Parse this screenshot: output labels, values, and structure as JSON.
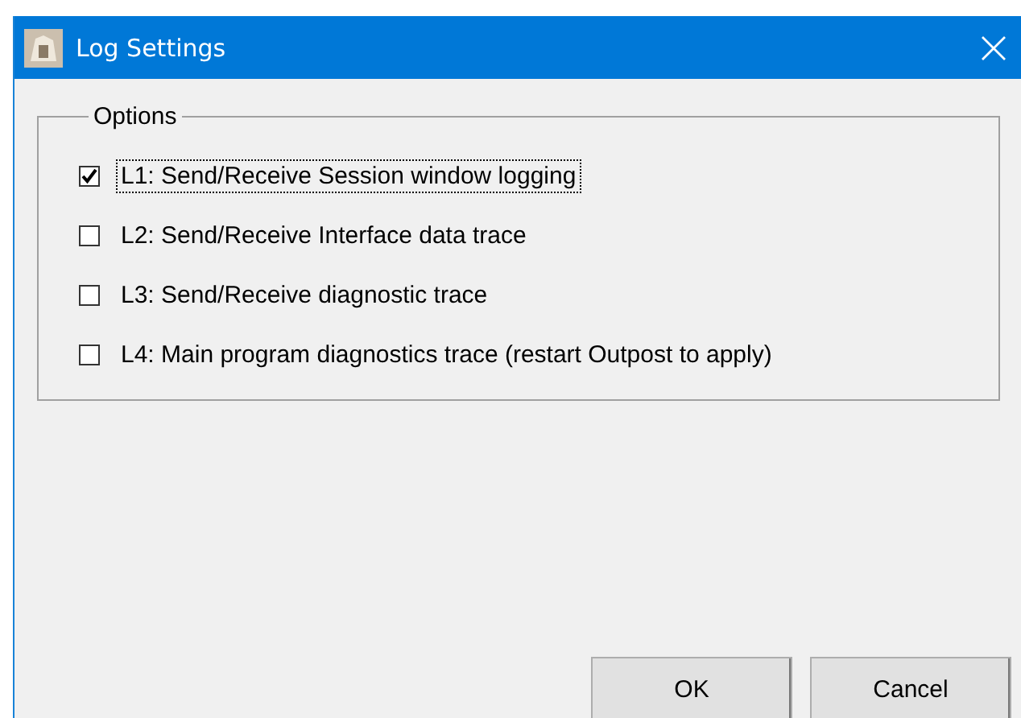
{
  "window": {
    "title": "Log Settings"
  },
  "options": {
    "title": "Options",
    "items": [
      {
        "label": "L1: Send/Receive Session window logging",
        "checked": true,
        "focused": true
      },
      {
        "label": "L2: Send/Receive Interface data trace",
        "checked": false,
        "focused": false
      },
      {
        "label": "L3: Send/Receive diagnostic trace",
        "checked": false,
        "focused": false
      },
      {
        "label": "L4: Main program diagnostics trace (restart Outpost to apply)",
        "checked": false,
        "focused": false
      }
    ]
  },
  "buttons": [
    "OK",
    "Cancel"
  ]
}
